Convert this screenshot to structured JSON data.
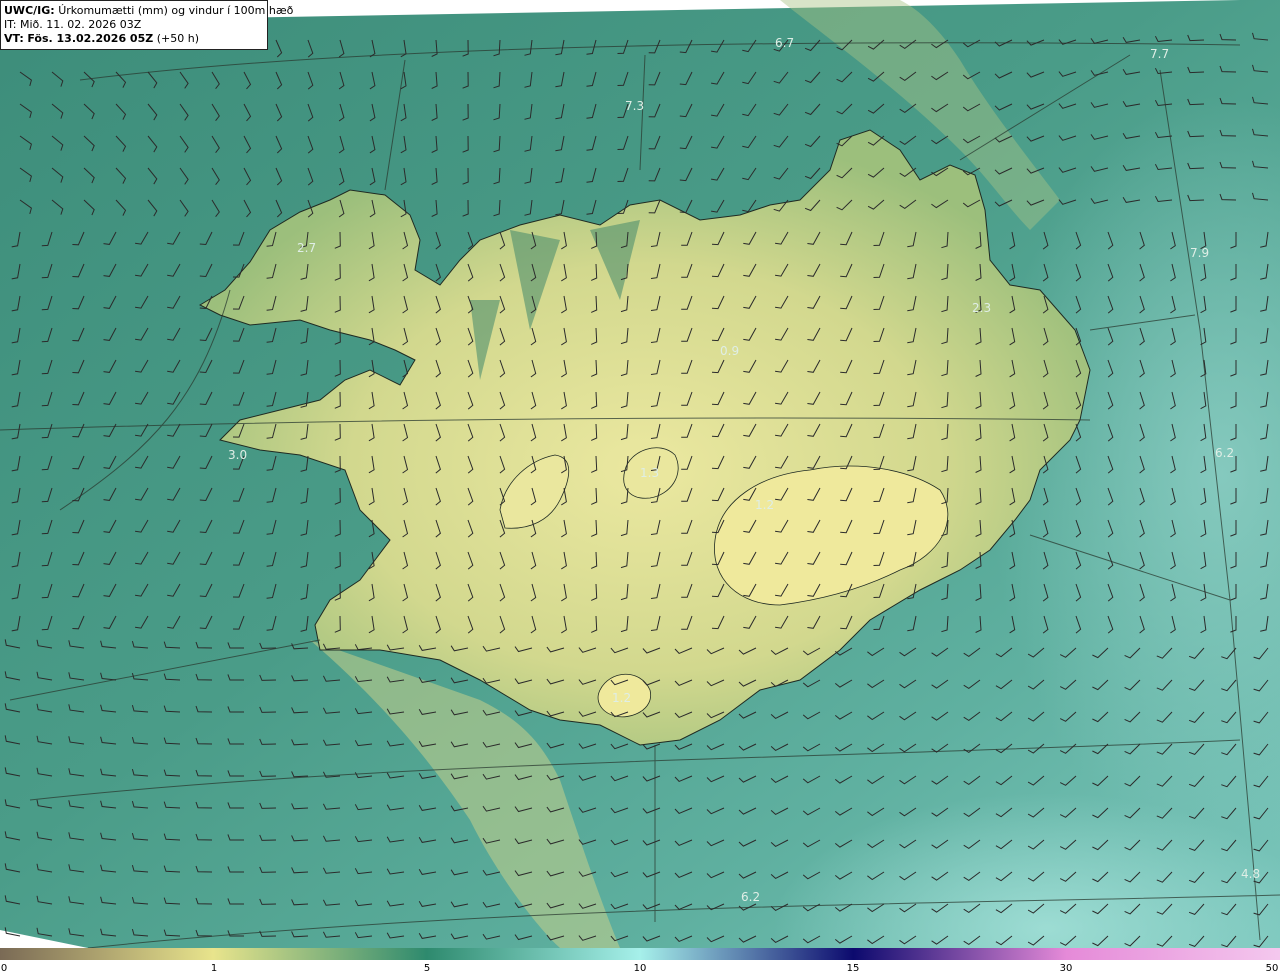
{
  "header": {
    "model": "UWC/IG:",
    "title": "Úrkomumætti (mm) og vindur í 100m hæð",
    "init_time": "IT: Mið. 11. 02. 2026 03Z",
    "valid_label": "VT:",
    "valid_time": "Fös. 13.02.2026 05Z",
    "lead": "(+50 h)"
  },
  "map_values": [
    {
      "text": "6.7"
    },
    {
      "text": "7.7"
    },
    {
      "text": "7.3"
    },
    {
      "text": "2.7"
    },
    {
      "text": "7.9"
    },
    {
      "text": "2.3"
    },
    {
      "text": "0.9"
    },
    {
      "text": "3.0"
    },
    {
      "text": "6.2"
    },
    {
      "text": "1.2"
    },
    {
      "text": "1.3"
    },
    {
      "text": "1.2"
    },
    {
      "text": "6.2"
    },
    {
      "text": "4.8"
    }
  ],
  "colorbar": {
    "ticks": [
      "0",
      "1",
      "5",
      "10",
      "15",
      "30",
      "50"
    ],
    "stops": [
      {
        "value": 0,
        "color": "#7a6a55"
      },
      {
        "value": 1,
        "color": "#e8e48c"
      },
      {
        "value": 5,
        "color": "#2e8a6e"
      },
      {
        "value": 10,
        "color": "#a6f0ea"
      },
      {
        "value": 15,
        "color": "#0c0a6e"
      },
      {
        "value": 30,
        "color": "#e58ad8"
      },
      {
        "value": 50,
        "color": "#f4c8ee"
      }
    ]
  },
  "colors": {
    "ocean": "#4f9f8e",
    "land": "#c9d488",
    "highland": "#e4e29a",
    "coast": "#1f2a22",
    "barb": "#2b2b2b"
  }
}
